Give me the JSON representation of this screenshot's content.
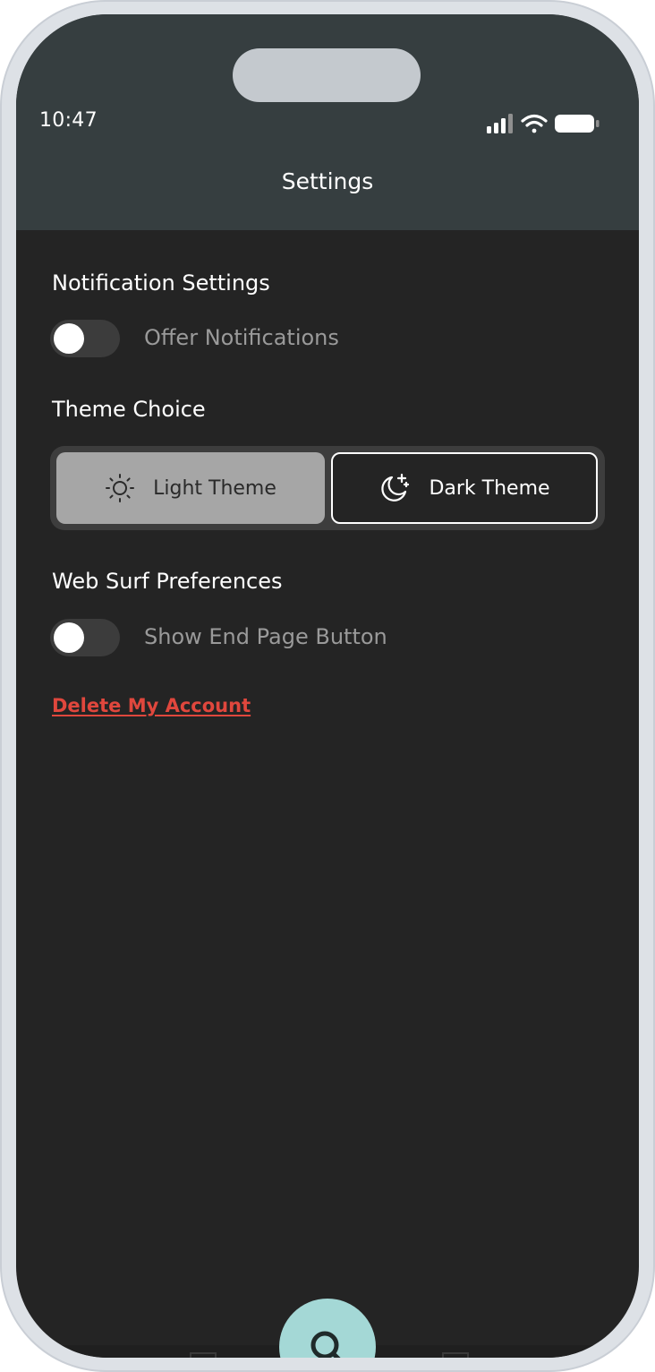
{
  "status_bar": {
    "time": "10:47",
    "icons": [
      "signal-bars-icon",
      "wifi-icon",
      "battery-icon"
    ]
  },
  "header": {
    "title": "Settings"
  },
  "notification_settings": {
    "heading": "Notification Settings",
    "toggle_label": "Offer Notifications",
    "enabled": false
  },
  "theme_choice": {
    "heading": "Theme Choice",
    "options": [
      {
        "label": "Light Theme",
        "icon": "sun-icon",
        "selected": true
      },
      {
        "label": "Dark Theme",
        "icon": "moon-stars-icon",
        "selected": false
      }
    ]
  },
  "web_surf_preferences": {
    "heading": "Web Surf Preferences",
    "toggle_label": "Show End Page Button",
    "enabled": false
  },
  "account": {
    "delete_label": "Delete My Account"
  },
  "bottom_nav": {
    "center_icon": "search-icon"
  },
  "colors": {
    "header_bg": "#363e40",
    "screen_bg": "#242424",
    "danger": "#e0473d",
    "fab_accent": "#a4d8d6",
    "selected_theme_bg": "#a6a6a6"
  }
}
